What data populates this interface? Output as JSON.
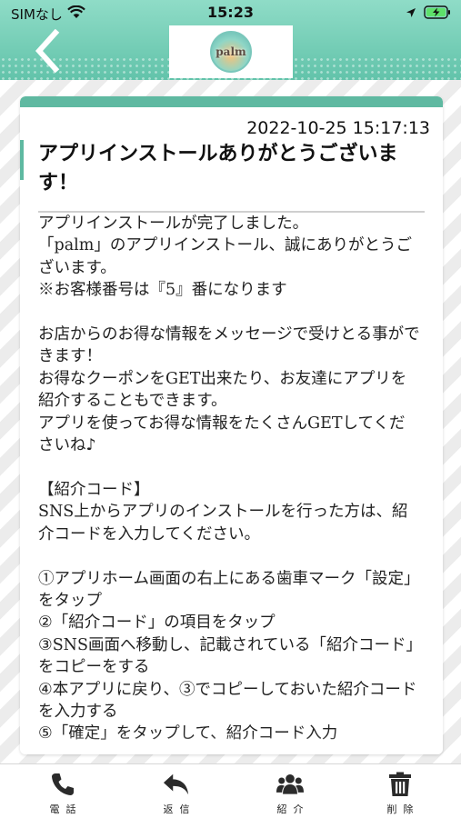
{
  "status_bar": {
    "carrier": "SIMなし",
    "time": "15:23"
  },
  "header": {
    "logo_text": "palm"
  },
  "message": {
    "timestamp": "2022-10-25 15:17:13",
    "title": "アプリインストールありがとうございます！",
    "body": "アプリインストールが完了しました。\n「palm」のアプリインストール、誠にありがとうございます。\n※お客様番号は『5』番になります\n\nお店からのお得な情報をメッセージで受けとる事ができます！\nお得なクーポンをGET出来たり、お友達にアプリを紹介することもできます。\nアプリを使ってお得な情報をたくさんGETしてくださいね♪\n\n【紹介コード】\nSNS上からアプリのインストールを行った方は、紹介コードを入力してください。\n\n①アプリホーム画面の右上にある歯車マーク「設定」をタップ\n②「紹介コード」の項目をタップ\n③SNS画面へ移動し、記載されている「紹介コード」をコピーをする\n④本アプリに戻り、③でコピーしておいた紹介コードを入力する\n⑤「確定」をタップして、紹介コード入力"
  },
  "tabs": [
    {
      "label": "電話",
      "icon": "phone-icon"
    },
    {
      "label": "返信",
      "icon": "reply-icon"
    },
    {
      "label": "紹介",
      "icon": "users-icon"
    },
    {
      "label": "削除",
      "icon": "trash-icon"
    }
  ],
  "colors": {
    "accent": "#5fb9a1",
    "header_top": "#8fdcc7",
    "header_bottom": "#62c3aa"
  }
}
